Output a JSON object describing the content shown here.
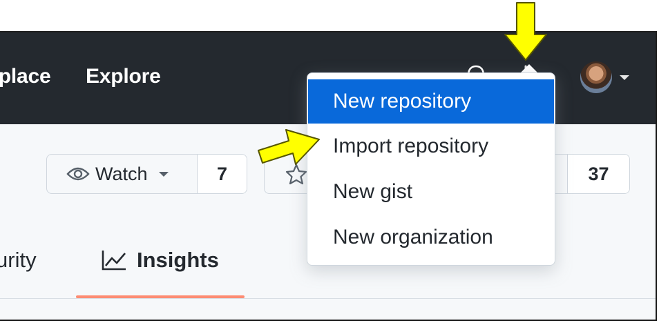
{
  "header": {
    "nav_marketplace": "tplace",
    "nav_explore": "Explore",
    "icons": [
      "bell-icon",
      "plus-icon",
      "caret-down-icon",
      "avatar"
    ]
  },
  "repo_actions": {
    "watch_label": "Watch",
    "watch_count": "7",
    "star_count": "37"
  },
  "tabs": {
    "security_label": "urity",
    "insights_label": "Insights"
  },
  "dropdown": {
    "items": [
      "New repository",
      "Import repository",
      "New gist",
      "New organization"
    ],
    "selected": "New repository"
  },
  "colors": {
    "header_bg": "#24292f",
    "accent_selected": "#0969da",
    "tab_underline": "#fd8c73",
    "callout_arrow": "#ffff00"
  }
}
